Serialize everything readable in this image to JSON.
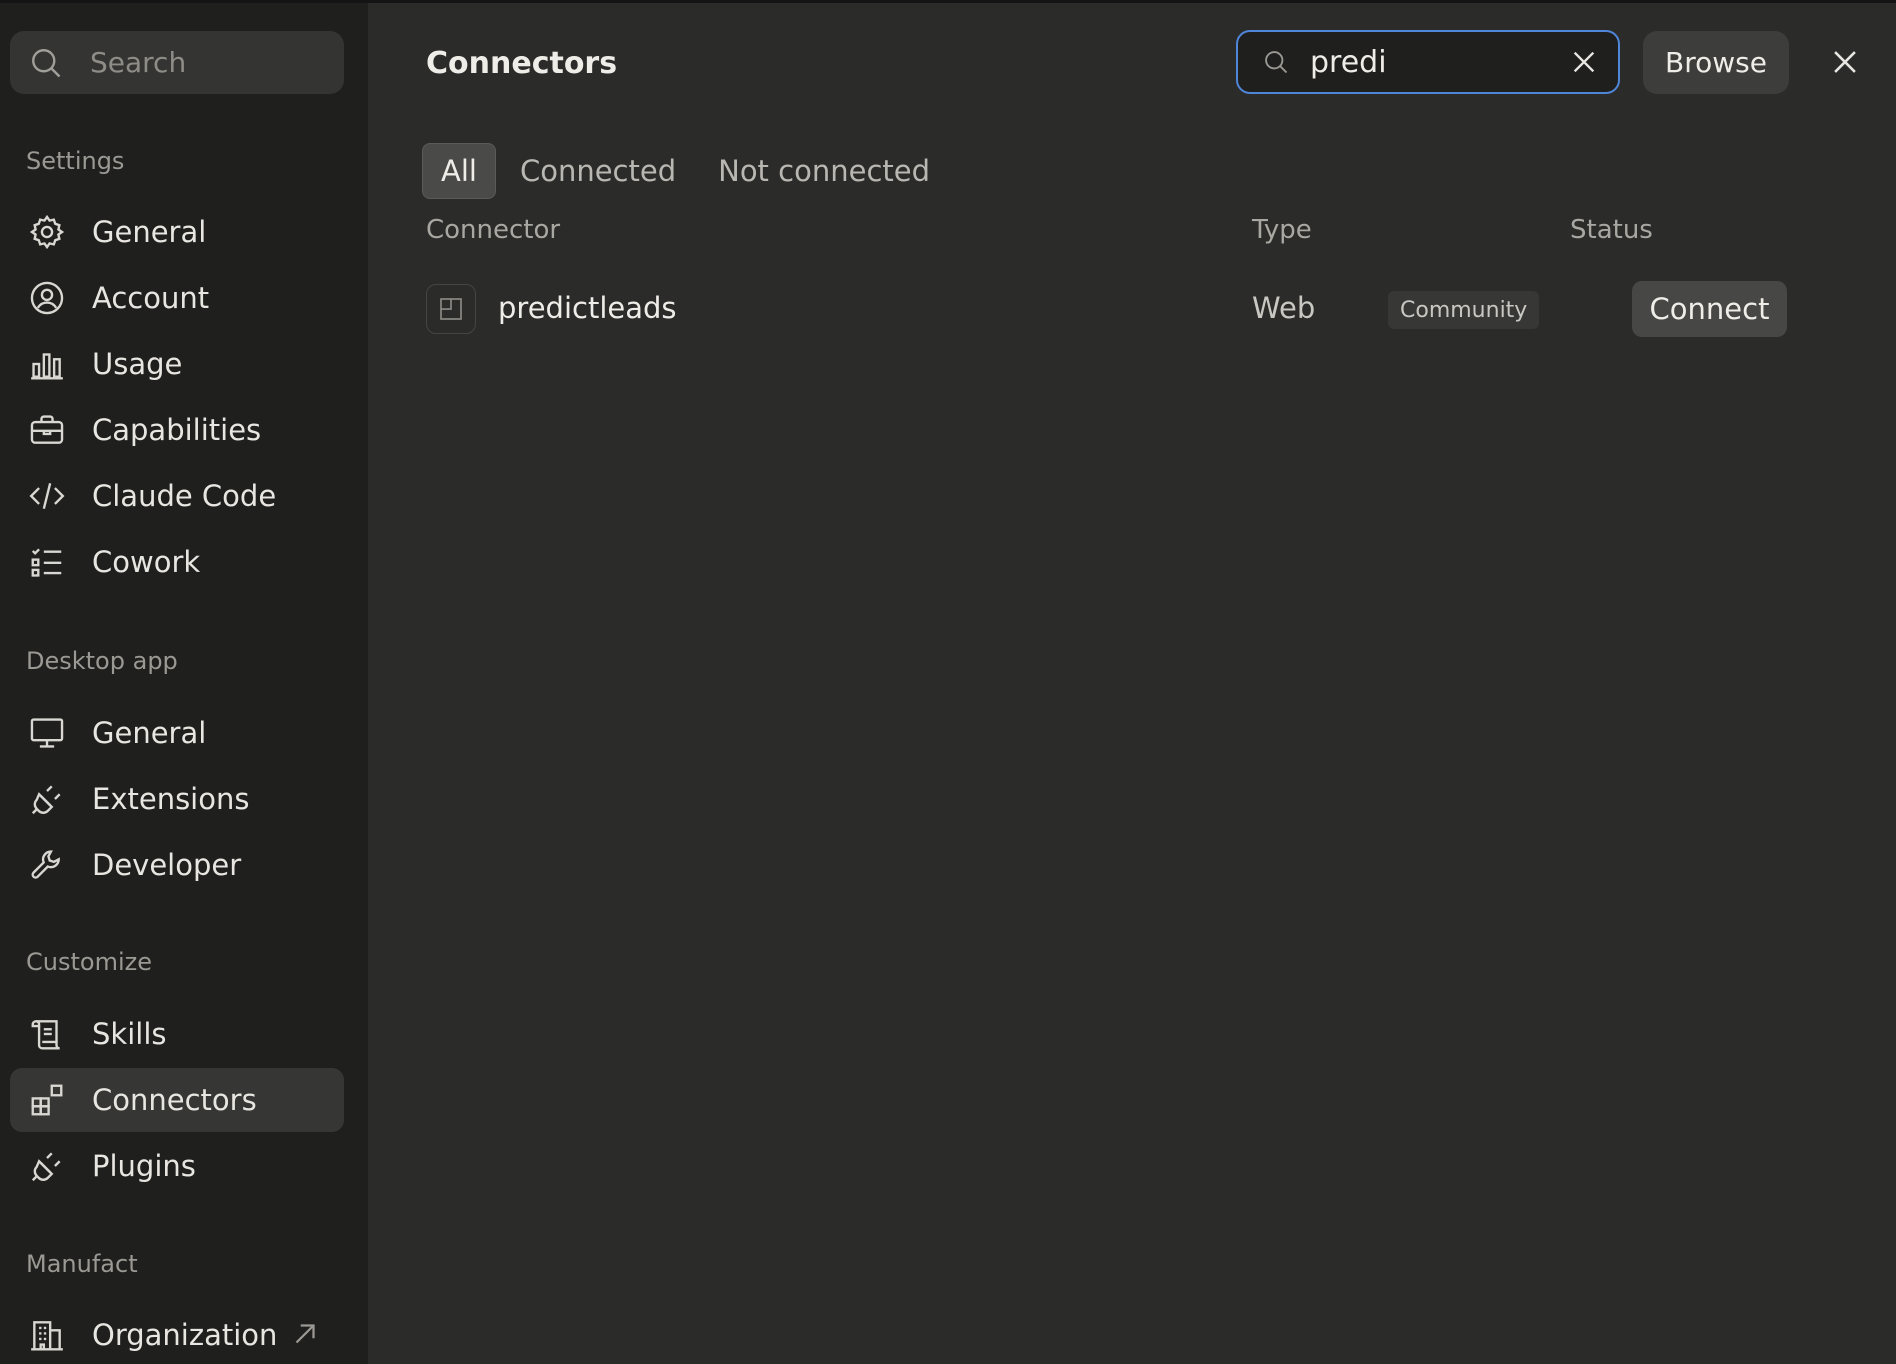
{
  "sidebar": {
    "search_placeholder": "Search",
    "sections": [
      {
        "label": "Settings",
        "items": [
          {
            "label": "General",
            "icon": "gear-icon"
          },
          {
            "label": "Account",
            "icon": "user-circle-icon"
          },
          {
            "label": "Usage",
            "icon": "bar-chart-icon"
          },
          {
            "label": "Capabilities",
            "icon": "briefcase-icon"
          },
          {
            "label": "Claude Code",
            "icon": "code-icon"
          },
          {
            "label": "Cowork",
            "icon": "checklist-icon"
          }
        ]
      },
      {
        "label": "Desktop app",
        "items": [
          {
            "label": "General",
            "icon": "monitor-icon"
          },
          {
            "label": "Extensions",
            "icon": "plug-icon"
          },
          {
            "label": "Developer",
            "icon": "wrench-icon"
          }
        ]
      },
      {
        "label": "Customize",
        "items": [
          {
            "label": "Skills",
            "icon": "scroll-icon"
          },
          {
            "label": "Connectors",
            "icon": "connectors-icon",
            "active": true
          },
          {
            "label": "Plugins",
            "icon": "plug-icon"
          }
        ]
      },
      {
        "label": "Manufact",
        "items": [
          {
            "label": "Organization",
            "icon": "building-icon",
            "external": true
          }
        ]
      }
    ]
  },
  "main": {
    "title": "Connectors",
    "filter": {
      "value": "predi"
    },
    "browse_label": "Browse",
    "tabs": [
      {
        "label": "All",
        "active": true
      },
      {
        "label": "Connected"
      },
      {
        "label": "Not connected"
      }
    ],
    "columns": {
      "connector": "Connector",
      "type": "Type",
      "status": "Status"
    },
    "rows": [
      {
        "name": "predictleads",
        "type": "Web",
        "badge": "Community",
        "action": "Connect"
      }
    ]
  }
}
